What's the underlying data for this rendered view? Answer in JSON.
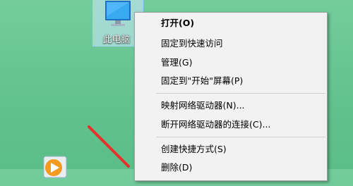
{
  "desktop": {
    "icons": [
      {
        "label": "此电脑",
        "icon": "computer-icon",
        "selected": true
      },
      {
        "label": "",
        "icon": "media-player-icon",
        "selected": false
      }
    ]
  },
  "context_menu": {
    "items": [
      {
        "label": "打开(O)",
        "bold": true
      },
      {
        "label": "固定到快速访问"
      },
      {
        "label": "管理(G)"
      },
      {
        "label": "固定到\"开始\"屏幕(P)"
      },
      {
        "label": "映射网络驱动器(N)..."
      },
      {
        "label": "断开网络驱动器的连接(C)..."
      },
      {
        "label": "创建快捷方式(S)"
      },
      {
        "label": "删除(D)"
      }
    ]
  },
  "annotation": {
    "type": "red-arrow-icon",
    "color": "#e8302a"
  },
  "colors": {
    "desktop_background": "#6cc693",
    "menu_background": "#f2f2f2",
    "selection_highlight": "#cce8ff"
  }
}
